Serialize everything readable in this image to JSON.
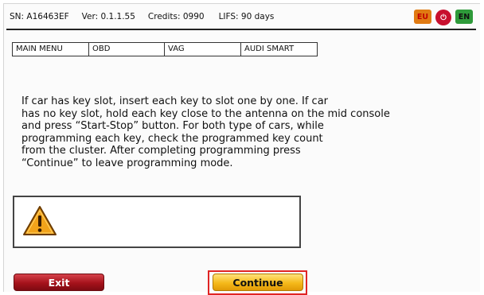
{
  "status": {
    "sn": "SN: A16463EF",
    "ver": "Ver: 0.1.1.55",
    "credits": "Credits: 0990",
    "lifs": "LIFS: 90 days"
  },
  "flags": {
    "eu": "EU",
    "usb": "⏻",
    "en": "EN"
  },
  "breadcrumb": [
    "MAIN MENU",
    "OBD",
    "VAG",
    "AUDI SMART"
  ],
  "instructions": "If car has key slot, insert each key to slot one by one. If car\nhas no key slot, hold each key close to the antenna on the mid console\nand press “Start-Stop” button. For both type of cars, while\nprogramming each key, check the programmed key count\nfrom the cluster. After completing programming press\n“Continue” to leave programming mode.",
  "buttons": {
    "exit": "Exit",
    "continue": "Continue"
  },
  "colors": {
    "exit": "#a5121b",
    "continue": "#f5b91a",
    "highlight": "#e02424",
    "warning": "#f2a31a"
  }
}
